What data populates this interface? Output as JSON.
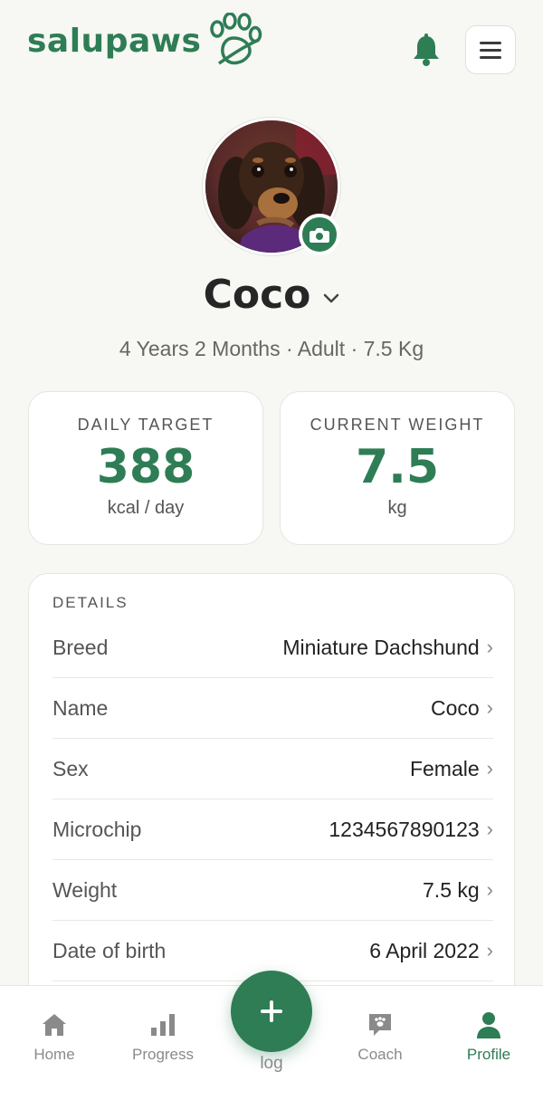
{
  "brand": {
    "name": "salupaws"
  },
  "pet": {
    "name": "Coco",
    "summary": "4 Years 2 Months · Adult · 7.5 Kg"
  },
  "stats": [
    {
      "label": "DAILY TARGET",
      "value": "388",
      "unit": "kcal / day"
    },
    {
      "label": "CURRENT WEIGHT",
      "value": "7.5",
      "unit": "kg"
    }
  ],
  "details": {
    "title": "DETAILS",
    "rows": [
      {
        "label": "Breed",
        "value": "Miniature Dachshund"
      },
      {
        "label": "Name",
        "value": "Coco"
      },
      {
        "label": "Sex",
        "value": "Female"
      },
      {
        "label": "Microchip",
        "value": "1234567890123"
      },
      {
        "label": "Weight",
        "value": "7.5 kg"
      },
      {
        "label": "Date of birth",
        "value": "6 April 2022"
      }
    ]
  },
  "nav": {
    "items": [
      {
        "label": "Home",
        "icon": "home-icon"
      },
      {
        "label": "Progress",
        "icon": "bar-chart-icon"
      },
      {
        "label": "log",
        "icon": "plus-icon"
      },
      {
        "label": "Coach",
        "icon": "chat-paw-icon"
      },
      {
        "label": "Profile",
        "icon": "person-icon"
      }
    ],
    "active": "Profile"
  },
  "colors": {
    "accent": "#2e7d55",
    "background": "#f7f7f3",
    "muted": "#8a8a8a"
  }
}
